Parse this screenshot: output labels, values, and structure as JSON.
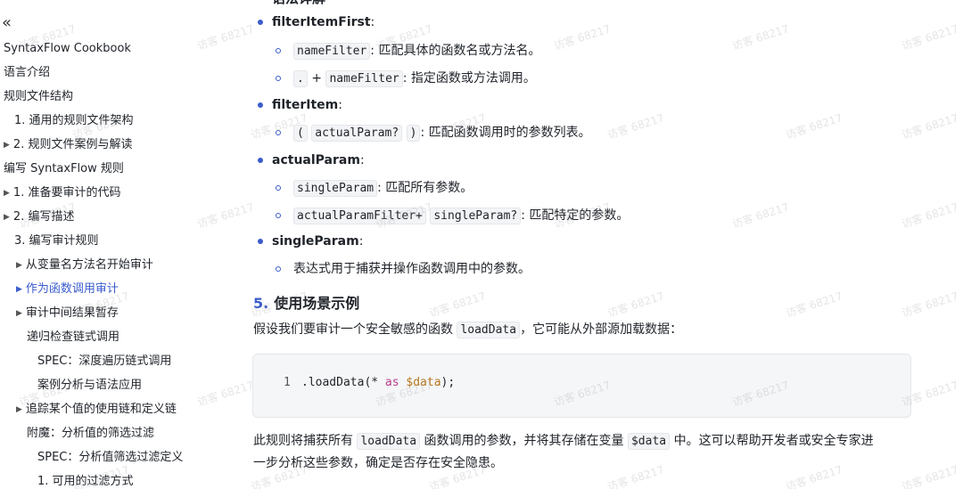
{
  "sidebar": {
    "collapse_icon": "double-chevron-left-icon",
    "items": [
      {
        "label": "SyntaxFlow Cookbook"
      },
      {
        "label": "语言介绍"
      },
      {
        "label": "规则文件结构"
      },
      {
        "label": "1. 通用的规则文件架构"
      },
      {
        "label": "2. 规则文件案例与解读"
      },
      {
        "label": "编写 SyntaxFlow 规则"
      },
      {
        "label": "1. 准备要审计的代码"
      },
      {
        "label": "2. 编写描述"
      },
      {
        "label": "3. 编写审计规则"
      },
      {
        "label": "从变量名方法名开始审计"
      },
      {
        "label": "作为函数调用审计"
      },
      {
        "label": "审计中间结果暂存"
      },
      {
        "label": "递归检查链式调用"
      },
      {
        "label": "SPEC：深度遍历链式调用"
      },
      {
        "label": "案例分析与语法应用"
      },
      {
        "label": "追踪某个值的使用链和定义链"
      },
      {
        "label": "附魔：分析值的筛选过滤"
      },
      {
        "label": "SPEC：分析值筛选过滤定义"
      },
      {
        "label": "1. 可用的过滤方式"
      }
    ]
  },
  "content": {
    "top_partial_heading": "语法详解",
    "filterItemFirst": {
      "term": "filterItemFirst",
      "colon": ":",
      "sub1_code": "nameFilter",
      "sub1_desc": ": 匹配具体的函数名或方法名。",
      "sub2_code1": ".",
      "sub2_plus": "+",
      "sub2_code2": "nameFilter",
      "sub2_desc": ": 指定函数或方法调用。"
    },
    "filterItem": {
      "term": "filterItem",
      "colon": ":",
      "sub1_code1": "(",
      "sub1_code2": "actualParam?",
      "sub1_code3": ")",
      "sub1_desc": ": 匹配函数调用时的参数列表。"
    },
    "actualParam": {
      "term": "actualParam",
      "colon": ":",
      "sub1_code": "singleParam",
      "sub1_desc": ": 匹配所有参数。",
      "sub2_code1": "actualParamFilter+",
      "sub2_code2": "singleParam?",
      "sub2_desc": ": 匹配特定的参数。"
    },
    "singleParam": {
      "term": "singleParam",
      "colon": ":",
      "sub1_desc": "表达式用于捕获并操作函数调用中的参数。"
    },
    "section5": {
      "number": "5.",
      "title": "使用场景示例",
      "intro_before": "假设我们要审计一个安全敏感的函数",
      "intro_code": "loadData",
      "intro_after": "，它可能从外部源加载数据："
    },
    "codeblock": {
      "line_number": "1",
      "code_prefix": ".loadData(* ",
      "code_kw": "as",
      "code_var": "$data",
      "code_suffix": ");"
    },
    "closing": {
      "p1_a": "此规则将捕获所有",
      "p1_code1": "loadData",
      "p1_b": "函数调用的参数，并将其存储在变量",
      "p1_code2": "$data",
      "p1_c": "中。这可以帮助开发者或安全专家进",
      "p2": "一步分析这些参数，确定是否存在安全隐患。"
    },
    "watermark_text": "访客 68217"
  },
  "colors": {
    "accent": "#3a5ccc",
    "text": "#1f2329",
    "code_bg": "#f5f6f7"
  }
}
